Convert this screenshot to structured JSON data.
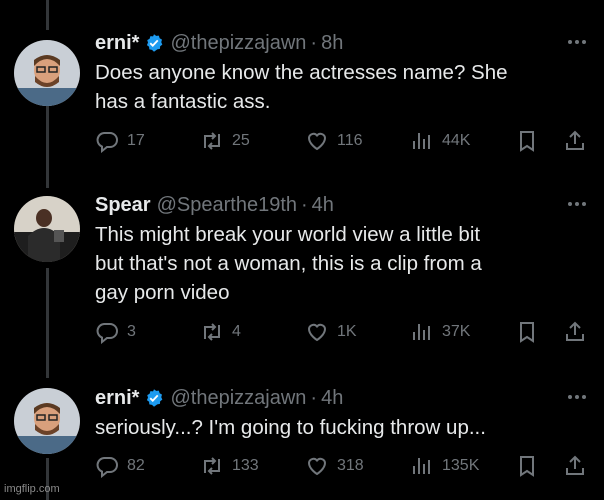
{
  "tweets": [
    {
      "name": "erni*",
      "verified": true,
      "handle": "@thepizzajawn",
      "time": "8h",
      "lines": [
        "Does anyone know the actresses name? She",
        "has a fantastic ass."
      ],
      "replies": "17",
      "retweets": "25",
      "likes": "116",
      "views": "44K"
    },
    {
      "name": "Spear",
      "verified": false,
      "handle": "@Spearthe19th",
      "time": "4h",
      "lines": [
        "This might break your world view a little bit",
        "but that's not a woman, this is a clip from a",
        "gay porn video"
      ],
      "replies": "3",
      "retweets": "4",
      "likes": "1K",
      "views": "37K"
    },
    {
      "name": "erni*",
      "verified": true,
      "handle": "@thepizzajawn",
      "time": "4h",
      "lines": [
        "seriously...? I'm going to fucking throw up..."
      ],
      "replies": "82",
      "retweets": "133",
      "likes": "318",
      "views": "135K"
    }
  ],
  "separator": "·",
  "watermark": "imgflip.com",
  "icons": {
    "reply": "reply-icon",
    "retweet": "retweet-icon",
    "like": "like-icon",
    "views": "views-icon",
    "bookmark": "bookmark-icon",
    "share": "share-icon",
    "more": "more-icon",
    "verified": "verified-badge-icon"
  },
  "colors": {
    "background": "#000000",
    "text": "#e7e9ea",
    "muted": "#71767b",
    "verified": "#1d9bf0"
  }
}
